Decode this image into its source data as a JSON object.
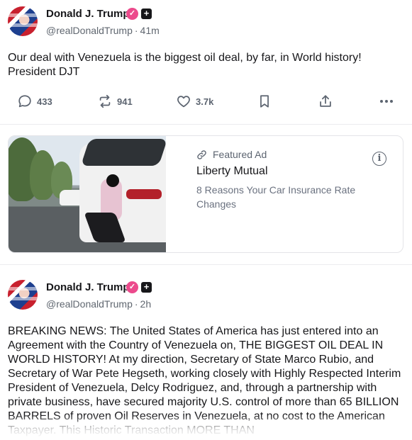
{
  "posts": [
    {
      "author": "Donald J. Trump",
      "handle": "@realDonaldTrump",
      "time": "41m",
      "text": "Our deal with Venezuela is the biggest oil deal, by far, in World history! President DJT",
      "actions": {
        "replies": "433",
        "reposts": "941",
        "likes": "3.7k"
      }
    },
    {
      "author": "Donald J. Trump",
      "handle": "@realDonaldTrump",
      "time": "2h",
      "text": "BREAKING NEWS: The United States of America has just entered into an Agreement with the Country of Venezuela on, THE BIGGEST OIL DEAL IN WORLD HISTORY! At my direction, Secretary of State Marco Rubio, and Secretary of War Pete Hegseth, working closely with Highly Respected Interim President of Venezuela, Delcy Rodriguez, and, through a partnership with private business, have secured majority U.S. control of more than 65 BILLION BARRELS of proven Oil Reserves in Venezuela, at no cost to the American Taxpayer. This Historic Transaction MORE THAN"
    }
  ],
  "ad": {
    "label": "Featured Ad",
    "title": "Liberty Mutual",
    "description": "8 Reasons Your Car Insurance Rate Changes",
    "info_symbol": "i"
  },
  "separator": "·",
  "icons": {
    "reply": "reply-icon",
    "repost": "repost-icon",
    "like": "heart-icon",
    "bookmark": "bookmark-icon",
    "share": "share-icon",
    "more": "more-icon",
    "verified": "verified-badge-icon",
    "plus": "plus-badge-icon",
    "link": "link-icon",
    "info": "info-icon"
  },
  "colors": {
    "verified_badge": "#ec4a8c",
    "text": "#17171a",
    "muted": "#606770"
  }
}
